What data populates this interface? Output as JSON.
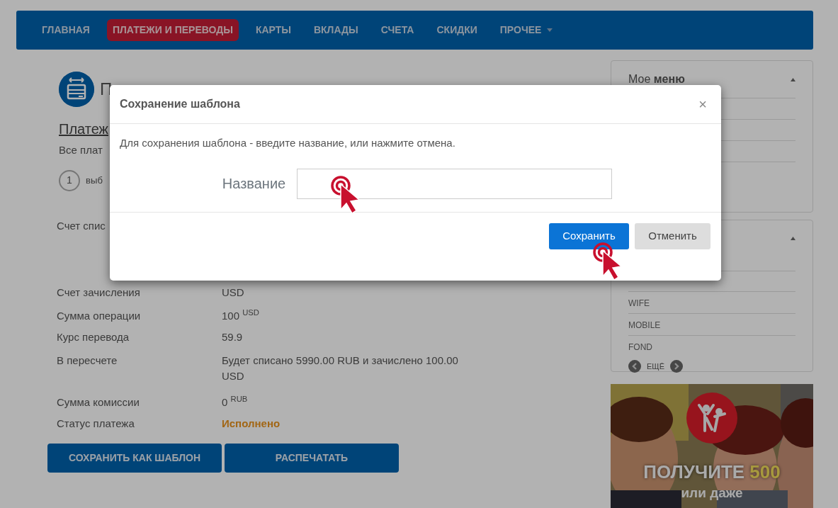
{
  "nav": {
    "items": [
      {
        "label": "ГЛАВНАЯ",
        "selected": false,
        "dropdown": false
      },
      {
        "label": "ПЛАТЕЖИ И ПЕРЕВОДЫ",
        "selected": true,
        "dropdown": false
      },
      {
        "label": "КАРТЫ",
        "selected": false,
        "dropdown": false
      },
      {
        "label": "ВКЛАДЫ",
        "selected": false,
        "dropdown": false
      },
      {
        "label": "СЧЕТА",
        "selected": false,
        "dropdown": false
      },
      {
        "label": "СКИДКИ",
        "selected": false,
        "dropdown": false
      },
      {
        "label": "ПРОЧЕЕ",
        "selected": false,
        "dropdown": true
      }
    ]
  },
  "page": {
    "title": "П",
    "breadcrumb": "Платеж",
    "subtitle": "Все плат",
    "step": {
      "number": "1",
      "label": "выб"
    },
    "details": [
      {
        "kind": "text",
        "label": "Счет спис"
      },
      {
        "kind": "text",
        "label": "Счет зачисления",
        "value": "USD"
      },
      {
        "kind": "text",
        "label": "Сумма операции",
        "value": "100",
        "unit": "USD"
      },
      {
        "kind": "text",
        "label": "Курс перевода",
        "value": "59.9"
      },
      {
        "kind": "text",
        "label": "В пересчете",
        "value": "Будет списано 5990.00 RUB и зачислено 100.00 USD"
      },
      {
        "kind": "text",
        "label": "Сумма комиссии",
        "value": "0",
        "unit": "RUB"
      },
      {
        "kind": "status",
        "label": "Статус платежа",
        "value": "Исполнено"
      }
    ],
    "buttons": [
      "СОХРАНИТЬ КАК ШАБЛОН",
      "РАСПЕЧАТАТЬ"
    ]
  },
  "sidebar": {
    "panels": [
      {
        "title": "Мое **меню**",
        "expanded": true
      },
      {
        "expanded": true,
        "items": [
          "WIFE",
          "MOBILE",
          "FOND"
        ],
        "pager": "ЕЩЁ"
      }
    ],
    "banner": {
      "kind": "picture",
      "headline": "ПОЛУЧИТЕ",
      "amount": "500",
      "subline": "или даже"
    }
  },
  "modal": {
    "title": "Сохранение шаблона",
    "close": "×",
    "message": "Для сохранения шаблона - введите название, или нажмите отмена.",
    "field_label": "Название",
    "buttons": [
      {
        "label": "Сохранить",
        "kind": "primary"
      },
      {
        "label": "Отменить",
        "kind": "secondary"
      }
    ]
  }
}
